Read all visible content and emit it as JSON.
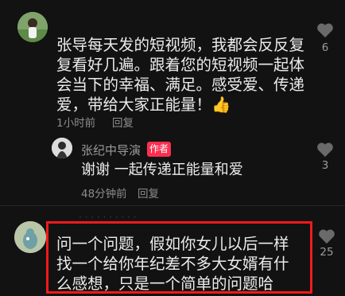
{
  "comments": [
    {
      "text": "张导每天发的短视频，我都会反反复复看好几遍。跟着您的短视频一起体会当下的幸福、满足。感受爱、传递爱，带给大家正能量！",
      "emoji": "👍",
      "time": "1小时前",
      "reply_label": "回复",
      "like_count": "6"
    },
    {
      "author": "张纪中导演",
      "badge": "作者",
      "text": "谢谢 一起传递正能量和爱",
      "time": "48分钟前",
      "reply_label": "回复",
      "like_count": "3"
    },
    {
      "username_partial": "· · · · · · · · · ·",
      "text": "问一个问题，假如你女儿以后一样找一个给你年纪差不多大女婿有什么感想，只是一个简单的问题哈",
      "like_count": "25"
    }
  ],
  "colors": {
    "background": "#121212",
    "badge": "#fb2f4f",
    "highlight": "#f21a1a"
  },
  "icons": [
    "heart-icon",
    "thumbs-up-icon"
  ]
}
